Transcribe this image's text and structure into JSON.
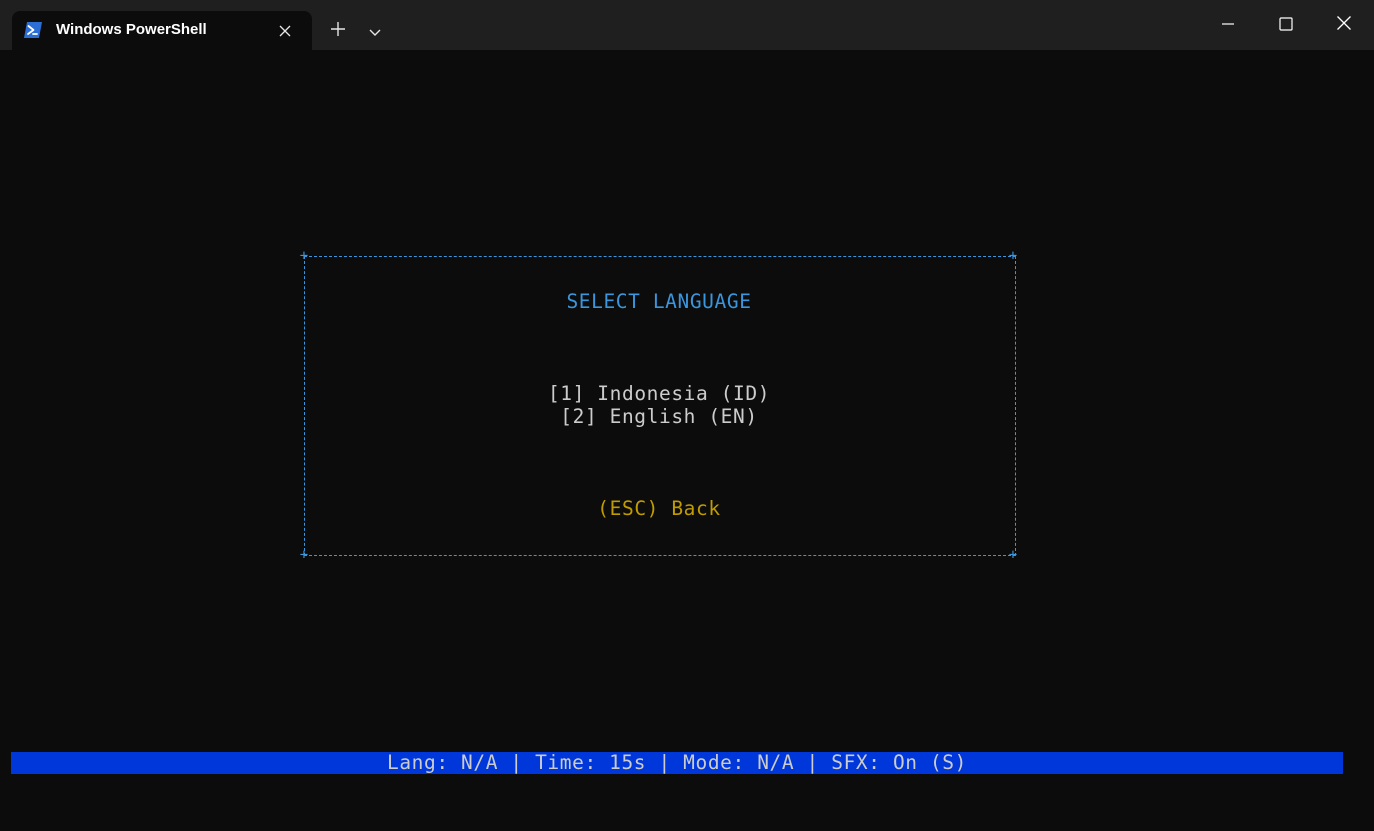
{
  "window": {
    "tab_title": "Windows PowerShell"
  },
  "icons": {
    "tab": "powershell-icon",
    "tab_close": "close-icon",
    "new_tab": "plus-icon",
    "dropdown": "chevron-down-icon",
    "minimize": "minimize-icon",
    "maximize": "maximize-icon",
    "close": "close-icon"
  },
  "colors": {
    "terminal_bg": "#0c0c0c",
    "titlebar_bg": "#1f1f1f",
    "border": "#3a96dd",
    "heading": "#3a96dd",
    "text": "#cccccc",
    "back": "#c19c00",
    "statusbar_bg": "#0037da"
  },
  "menu": {
    "title": "SELECT LANGUAGE",
    "options": [
      "[1] Indonesia (ID)",
      "[2] English (EN)"
    ],
    "back": "(ESC) Back"
  },
  "statusbar": {
    "text": "Lang: N/A | Time: 15s | Mode: N/A | SFX: On (S)"
  }
}
